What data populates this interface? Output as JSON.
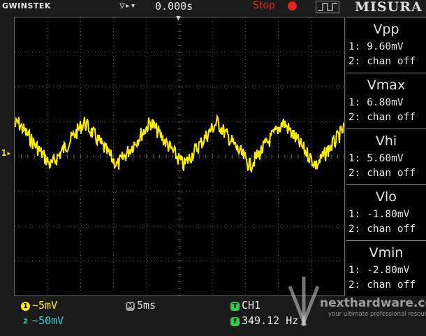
{
  "header": {
    "brand": "GWINSTEK",
    "trigger_arrows": "▽▸▾",
    "time_offset": "0.000s",
    "run_state": "Stop",
    "edge_icon": "rising-edge-icon",
    "section_label": "MISURA"
  },
  "screen": {
    "trigger_position_marker": "▼",
    "channel1_marker": "1▸",
    "trace_color": "#ffee00",
    "grid_color": "#5a5a5a"
  },
  "measurements": [
    {
      "title": "Vpp",
      "ch1": "1: 9.60mV",
      "ch2": "2: chan off"
    },
    {
      "title": "Vmax",
      "ch1": "1: 6.80mV",
      "ch2": "2: chan off"
    },
    {
      "title": "Vhi",
      "ch1": "1: 5.60mV",
      "ch2": "2: chan off"
    },
    {
      "title": "Vlo",
      "ch1": "1: -1.80mV",
      "ch2": "2: chan off"
    },
    {
      "title": "Vmin",
      "ch1": "1: -2.80mV",
      "ch2": "2: chan off"
    }
  ],
  "footer": {
    "ch1_badge": "1",
    "ch1_scale": "~5mV",
    "ch2_badge": "2",
    "ch2_scale": "~50mV",
    "timebase_badge": "M",
    "timebase": "5ms",
    "trigger_badge": "T",
    "trigger_source": "CH1",
    "freq_badge": "f",
    "frequency": "349.12 Hz",
    "ch1_color": "#ffee00",
    "ch2_color": "#33d0e0",
    "trig_color": "#2fd14a"
  },
  "watermark": {
    "name": "nexthardware.com",
    "tagline": "your ultimate professional resource"
  }
}
